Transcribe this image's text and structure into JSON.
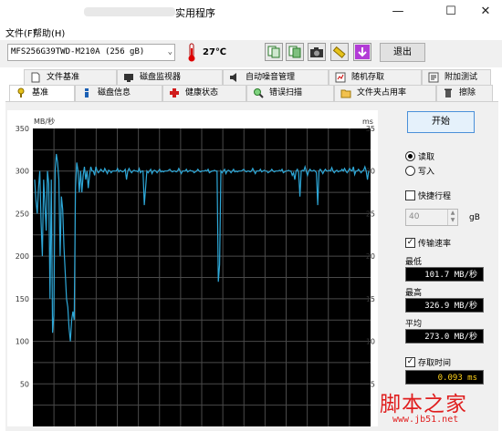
{
  "window": {
    "title": "实用程序",
    "minimize_glyph": "—",
    "maximize_glyph": "☐",
    "close_glyph": "✕"
  },
  "menu": {
    "items": [
      {
        "label": "文件(F)"
      },
      {
        "label": "帮助(H)"
      }
    ]
  },
  "toolbar": {
    "drive": "MFS256G39TWD-M210A (256 gB)",
    "temperature": "27℃",
    "exit_label": "退出",
    "icons": [
      "copy-text-icon",
      "copy-report-icon",
      "screenshot-camera-icon",
      "options-wrench-icon",
      "save-download-icon"
    ]
  },
  "tabs": {
    "row1": [
      {
        "label": "文件基准",
        "icon": "file-icon"
      },
      {
        "label": "磁盘监视器",
        "icon": "monitor-icon"
      },
      {
        "label": "自动噪音管理",
        "icon": "speaker-icon"
      },
      {
        "label": "随机存取",
        "icon": "random-access-icon"
      },
      {
        "label": "附加测试",
        "icon": "extra-tests-icon"
      }
    ],
    "row2": [
      {
        "label": "基准",
        "icon": "benchmark-icon",
        "active": true
      },
      {
        "label": "磁盘信息",
        "icon": "info-icon"
      },
      {
        "label": "健康状态",
        "icon": "health-cross-icon"
      },
      {
        "label": "错误扫描",
        "icon": "magnifier-icon"
      },
      {
        "label": "文件夹占用率",
        "icon": "folder-icon"
      },
      {
        "label": "擦除",
        "icon": "trash-icon"
      }
    ]
  },
  "controls": {
    "start_label": "开始",
    "read_label": "读取",
    "write_label": "写入",
    "mode_selected": "read",
    "short_stroke_label": "快捷行程",
    "short_stroke_checked": false,
    "short_stroke_value": "40",
    "short_stroke_unit": "gB",
    "transfer_rate_label": "传输速率",
    "transfer_rate_checked": true,
    "min_label": "最低",
    "min_value": "101.7 MB/秒",
    "max_label": "最高",
    "max_value": "326.9 MB/秒",
    "avg_label": "平均",
    "avg_value": "273.0 MB/秒",
    "access_time_label": "存取时间",
    "access_time_checked": true,
    "access_time_value": "0.093 ms"
  },
  "watermark": {
    "brand": "脚本之家",
    "url": "www.jb51.net"
  },
  "colors": {
    "chart_bg": "#000000",
    "grid": "#4a4a4a",
    "series": "#2ea8d8",
    "accent_red": "#e01e1e"
  },
  "chart_data": {
    "type": "line",
    "ylabel_left": "MB/秒",
    "ylabel_right": "ms",
    "ylim": [
      0,
      350
    ],
    "ylim_right": [
      0,
      35
    ],
    "left_ticks": [
      "350",
      "300",
      "250",
      "200",
      "150",
      "100",
      "50"
    ],
    "right_ticks": [
      "35",
      "30",
      "25",
      "20",
      "15",
      "10",
      "5"
    ],
    "grid": true,
    "series": [
      {
        "values": [
          290,
          265,
          250,
          280,
          300,
          240,
          200,
          290,
          260,
          230,
          300,
          285,
          150,
          290,
          110,
          130,
          300,
          320,
          310,
          290,
          200,
          270,
          255,
          210,
          180,
          150,
          140,
          115,
          100,
          125,
          135,
          125,
          280,
          310,
          300,
          275,
          300,
          275,
          295,
          305,
          290,
          300,
          280,
          295,
          305,
          300,
          300,
          295,
          305,
          300,
          298,
          300,
          302,
          300,
          299,
          303,
          300,
          297,
          301,
          300,
          298,
          300,
          300,
          300,
          300,
          303,
          299,
          301,
          300,
          299,
          300,
          302,
          290,
          300,
          303,
          300,
          298,
          300,
          301,
          300,
          300,
          299,
          303,
          298,
          300,
          300,
          260,
          280,
          300,
          298,
          300,
          302,
          297,
          300,
          301,
          300,
          298,
          300,
          302,
          299,
          300,
          299,
          300,
          300,
          300,
          301,
          302,
          300,
          299,
          300,
          300,
          299,
          300,
          303,
          300,
          297,
          300,
          300,
          300,
          302,
          299,
          300,
          301,
          300,
          300,
          298,
          299,
          300,
          302,
          300,
          299,
          300,
          300,
          300,
          301,
          300,
          302,
          298,
          299,
          300,
          300,
          301,
          300,
          300,
          170,
          190,
          300,
          298,
          300,
          302,
          297,
          300,
          301,
          300,
          298,
          300,
          302,
          299,
          300,
          299,
          300,
          300,
          300,
          301,
          302,
          300,
          299,
          300,
          300,
          299,
          300,
          303,
          300,
          297,
          300,
          300,
          300,
          302,
          299,
          300,
          301,
          300,
          300,
          298,
          299,
          300,
          302,
          300,
          299,
          300,
          300,
          300,
          301,
          300,
          302,
          298,
          299,
          300,
          300,
          301,
          300,
          300,
          295,
          298,
          290,
          300,
          302,
          298,
          270,
          300,
          301,
          300,
          305,
          300,
          295,
          300,
          302,
          300,
          300,
          301,
          300,
          298,
          260,
          300,
          302,
          300,
          297,
          300,
          302,
          300,
          300,
          301,
          300,
          304,
          300,
          298,
          300,
          301,
          299,
          300,
          300,
          302,
          300,
          303,
          300,
          298,
          300,
          303,
          301,
          300,
          305,
          296,
          300,
          300,
          302,
          300,
          298,
          300,
          301,
          305,
          300,
          290,
          300
        ]
      }
    ]
  }
}
